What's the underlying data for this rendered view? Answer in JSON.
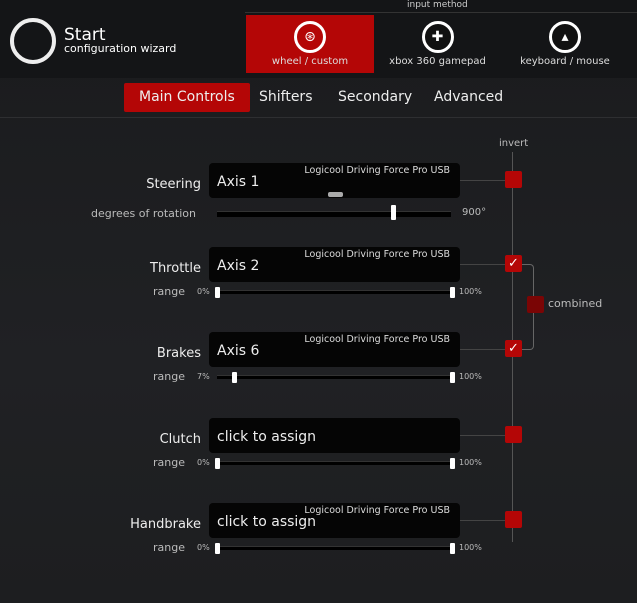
{
  "header": {
    "title": "Start",
    "subtitle": "configuration wizard",
    "input_method_label": "input method",
    "methods": [
      {
        "label": "wheel / custom",
        "icon": "steering-wheel-icon",
        "active": true
      },
      {
        "label": "xbox 360 gamepad",
        "icon": "gamepad-icon",
        "active": false
      },
      {
        "label": "keyboard / mouse",
        "icon": "keyboard-icon",
        "active": false
      }
    ]
  },
  "tabs": [
    {
      "label": "Main Controls",
      "active": true
    },
    {
      "label": "Shifters"
    },
    {
      "label": "Secondary"
    },
    {
      "label": "Advanced"
    }
  ],
  "invert_label": "invert",
  "combined_label": "combined",
  "combined_checked": false,
  "accent": "#b40606",
  "controls": [
    {
      "label": "Steering",
      "device": "Logicool Driving Force Pro USB",
      "value": "Axis 1",
      "inverted": false,
      "sub_label": "degrees of rotation",
      "rotation": "900°",
      "rotation_fraction": 0.75
    },
    {
      "label": "Throttle",
      "device": "Logicool Driving Force Pro USB",
      "value": "Axis 2",
      "inverted": true,
      "sub_label": "range",
      "min": "0%",
      "max": "100%",
      "min_v": 0,
      "max_v": 100
    },
    {
      "label": "Brakes",
      "device": "Logicool Driving Force Pro USB",
      "value": "Axis 6",
      "inverted": true,
      "sub_label": "range",
      "min": "7%",
      "max": "100%",
      "min_v": 7,
      "max_v": 100
    },
    {
      "label": "Clutch",
      "device": "",
      "value": "click to assign",
      "inverted": false,
      "sub_label": "range",
      "min": "0%",
      "max": "100%",
      "min_v": 0,
      "max_v": 100
    },
    {
      "label": "Handbrake",
      "device": "Logicool Driving Force Pro USB",
      "value": "click to assign",
      "inverted": false,
      "sub_label": "range",
      "min": "0%",
      "max": "100%",
      "min_v": 0,
      "max_v": 100
    }
  ]
}
